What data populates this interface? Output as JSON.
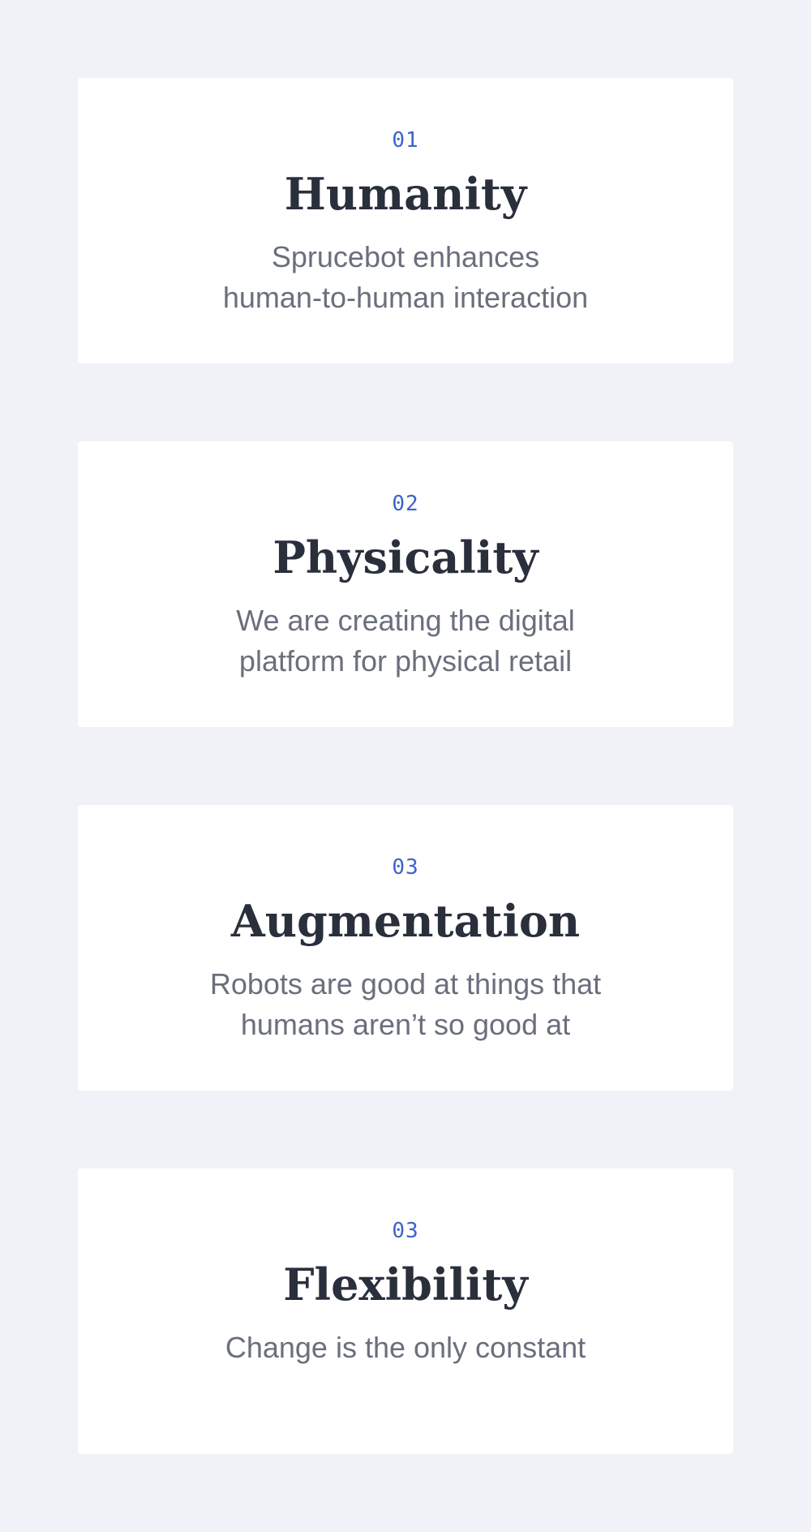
{
  "values": [
    {
      "number": "01",
      "title": "Humanity",
      "description_lines": [
        "Sprucebot enhances",
        "human-to-human interaction"
      ]
    },
    {
      "number": "02",
      "title": "Physicality",
      "description_lines": [
        "We are creating the digital",
        "platform for physical retail"
      ]
    },
    {
      "number": "03",
      "title": "Augmentation",
      "description_lines": [
        "Robots are good at things that",
        "humans aren’t so good at"
      ]
    },
    {
      "number": "03",
      "title": "Flexibility",
      "description_lines": [
        "Change is the only constant"
      ]
    }
  ],
  "colors": {
    "page_background": "#f0f2f7",
    "card_background": "#ffffff",
    "number": "#3a63cc",
    "title": "#2a2f3c",
    "description": "#6a6f7d"
  }
}
